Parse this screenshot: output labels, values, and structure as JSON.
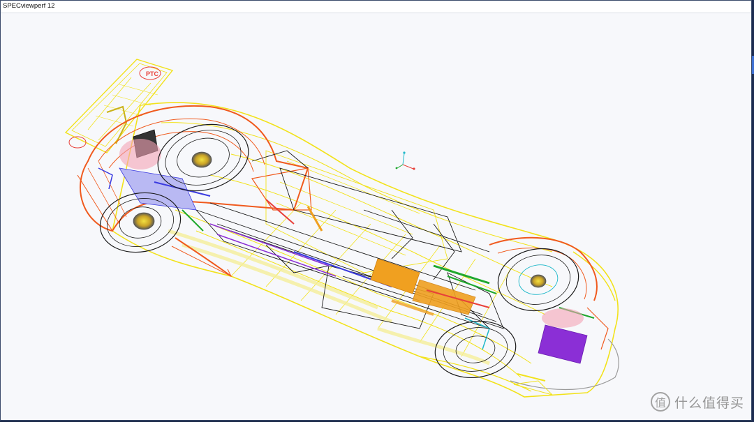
{
  "window": {
    "title": "SPECviewperf 12"
  },
  "scene": {
    "description_icon": "wireframe-race-car-model",
    "colors": {
      "orange": "#f05a1e",
      "yellow": "#f2e21a",
      "pale_yellow": "#f5ef9a",
      "black": "#1a1a1a",
      "blue": "#3a3ae0",
      "purple": "#8b2fd6",
      "green": "#1fa82e",
      "gray": "#9a9a9a",
      "pink": "#f3a3b5",
      "lavender": "#b9b9f3"
    },
    "spoiler_logo_text": "PTC"
  },
  "watermark": {
    "logo_glyph": "值",
    "text": "什么值得买"
  }
}
